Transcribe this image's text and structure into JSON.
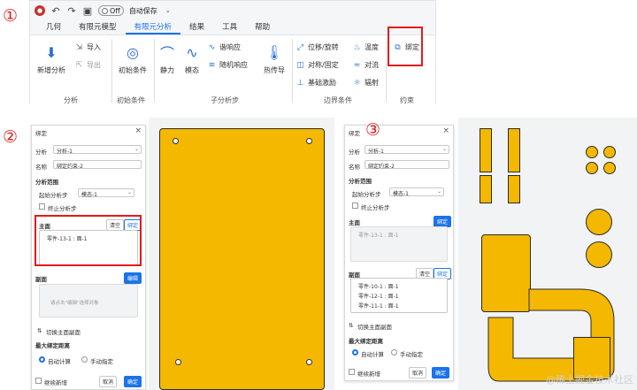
{
  "markers": [
    "①",
    "②",
    "③"
  ],
  "ribbon": {
    "autosave_toggle": "Off",
    "autosave_label": "自动保存",
    "tabs": [
      "几何",
      "有限元模型",
      "有限元分析",
      "结果",
      "工具",
      "帮助"
    ],
    "active_tab": "有限元分析",
    "analysis": {
      "new_analysis": "新增分析",
      "import": "导入",
      "export": "导出",
      "group": "分析"
    },
    "initial": {
      "initial_condition": "初始条件",
      "group": "初始条件"
    },
    "substeps": {
      "static": "静力",
      "modal": "模态",
      "harmonic": "谐响应",
      "random": "随机响应",
      "heat": "热传导",
      "group": "子分析步"
    },
    "boundary": {
      "disp": "位移/旋转",
      "temp": "温度",
      "symm": "对称/固定",
      "convection": "对流",
      "base": "基础激励",
      "radiation": "辐射",
      "group": "边界条件"
    },
    "constraint": {
      "bind": "绑定",
      "group": "约束"
    }
  },
  "panel1": {
    "title": "绑定",
    "analysis_label": "分析",
    "analysis_value": "分析-1",
    "name_label": "名称",
    "name_value": "绑定约束-2",
    "range_title": "分析范围",
    "start_step_label": "起始分析步",
    "start_step_value": "模态-1",
    "stop_step_label": "终止分析步",
    "master_title": "主面",
    "clear": "清空",
    "bind": "绑定",
    "master_item": "零件-13-1 : 面-1",
    "slave_title": "副面",
    "edit": "编辑",
    "slave_hint": "请点击\"编辑\"选择对象",
    "switch": "切换主面副面",
    "maxdist_title": "最大绑定距离",
    "auto": "自动计算",
    "manual": "手动指定",
    "continue_new": "继续新增",
    "cancel": "取消",
    "ok": "确定"
  },
  "panel2": {
    "title": "绑定",
    "analysis_label": "分析",
    "analysis_value": "分析-1",
    "name_label": "名称",
    "name_value": "绑定约束-2",
    "range_title": "分析范围",
    "start_step_label": "起始分析步",
    "start_step_value": "模态-1",
    "stop_step_label": "终止分析步",
    "master_title": "主面",
    "bind": "绑定",
    "master_item": "零件-13-1 : 面-1",
    "slave_title": "副面",
    "clear": "清空",
    "slave_items": [
      "零件-10-1 : 面-1",
      "零件-12-1 : 面-1",
      "零件-11-1 : 面-1"
    ],
    "switch": "切换主面副面",
    "maxdist_title": "最大绑定距离",
    "auto": "自动计算",
    "manual": "手动指定",
    "continue_new": "继续新增",
    "cancel": "取消",
    "ok": "确定"
  },
  "watermark": "@稀土掘金技术社区",
  "colors": {
    "accent": "#1a73e8",
    "highlight": "#e11b1b",
    "part": "#f5b800"
  }
}
